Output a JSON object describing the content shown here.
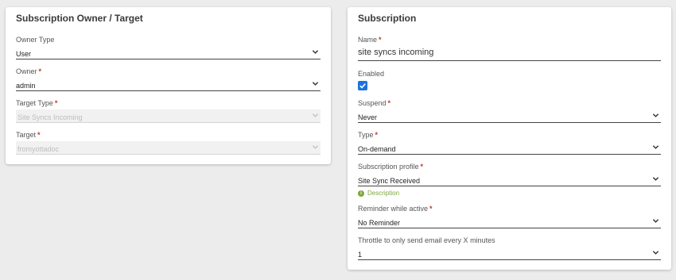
{
  "owner_card": {
    "title": "Subscription Owner / Target",
    "owner_type": {
      "label": "Owner Type",
      "value": "User"
    },
    "owner": {
      "label": "Owner",
      "value": "admin"
    },
    "target_type": {
      "label": "Target Type",
      "value": "Site Syncs Incoming"
    },
    "target": {
      "label": "Target",
      "value": "fromyottadoc"
    }
  },
  "subscription_card": {
    "title": "Subscription",
    "name": {
      "label": "Name",
      "value": "site syncs incoming"
    },
    "enabled": {
      "label": "Enabled",
      "checked": true
    },
    "suspend": {
      "label": "Suspend",
      "value": "Never"
    },
    "type": {
      "label": "Type",
      "value": "On-demand"
    },
    "profile": {
      "label": "Subscription profile",
      "value": "Site Sync Received",
      "description": "Description"
    },
    "reminder": {
      "label": "Reminder while active",
      "value": "No Reminder"
    },
    "throttle": {
      "label": "Throttle to only send email every X minutes",
      "value": "1"
    }
  },
  "required_marker": "*",
  "colors": {
    "accent": "#1e73d8",
    "required": "#c0392b",
    "description": "#7aa83a"
  },
  "icons": {
    "dropdown": "chevron-down-icon",
    "check": "check-icon",
    "info": "info-icon"
  }
}
